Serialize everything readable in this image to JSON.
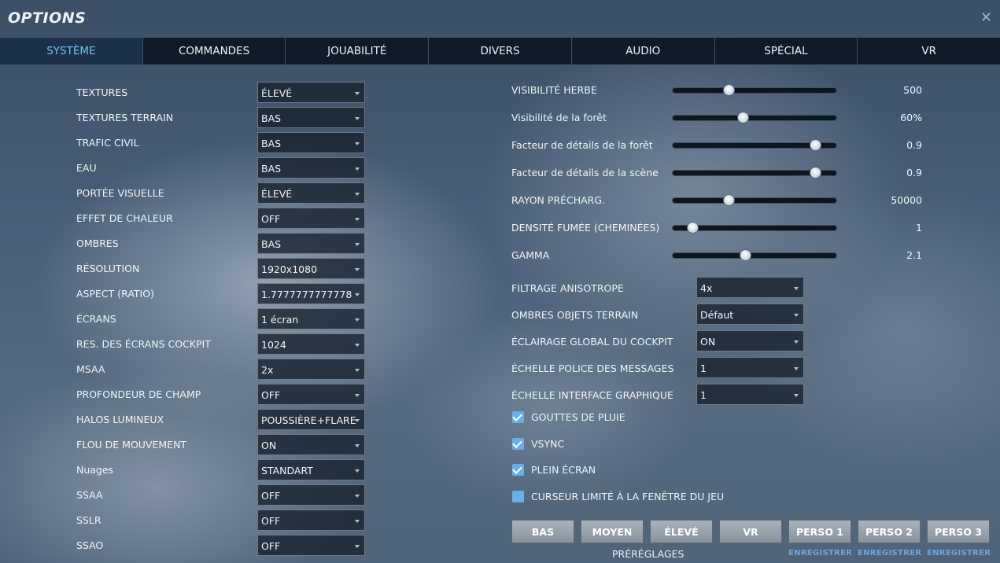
{
  "window": {
    "title": "OPTIONS",
    "close_glyph": "✕"
  },
  "tabs": [
    {
      "label": "SYSTÈME",
      "active": true
    },
    {
      "label": "COMMANDES",
      "active": false
    },
    {
      "label": "JOUABILITÉ",
      "active": false
    },
    {
      "label": "DIVERS",
      "active": false
    },
    {
      "label": "AUDIO",
      "active": false
    },
    {
      "label": "SPÉCIAL",
      "active": false
    },
    {
      "label": "VR",
      "active": false
    }
  ],
  "left_settings": [
    {
      "label": "TEXTURES",
      "value": "ÉLEVÉ"
    },
    {
      "label": "TEXTURES TERRAIN",
      "value": "BAS"
    },
    {
      "label": "TRAFIC CIVIL",
      "value": "BAS"
    },
    {
      "label": "EAU",
      "value": "BAS"
    },
    {
      "label": "PORTÉE VISUELLE",
      "value": "ÉLEVÉ"
    },
    {
      "label": "EFFET DE CHALEUR",
      "value": "OFF"
    },
    {
      "label": "OMBRES",
      "value": "BAS"
    },
    {
      "label": "RÉSOLUTION",
      "value": "1920x1080"
    },
    {
      "label": "ASPECT (RATIO)",
      "value": "1.7777777777778"
    },
    {
      "label": "ÉCRANS",
      "value": "1 écran"
    },
    {
      "label": "RES. DES ÉCRANS COCKPIT",
      "value": "1024"
    },
    {
      "label": "MSAA",
      "value": "2x"
    },
    {
      "label": "PROFONDEUR DE CHAMP",
      "value": "OFF"
    },
    {
      "label": "HALOS LUMINEUX",
      "value": "POUSSIÈRE+FLARE"
    },
    {
      "label": "FLOU DE MOUVEMENT",
      "value": "ON"
    },
    {
      "label": "Nuages",
      "value": "STANDART"
    },
    {
      "label": "SSAA",
      "value": "OFF"
    },
    {
      "label": "SSLR",
      "value": "OFF"
    },
    {
      "label": "SSAO",
      "value": "OFF"
    }
  ],
  "sliders": [
    {
      "label": "VISIBILITÉ HERBE",
      "value": "500",
      "level_pct": 34
    },
    {
      "label": "Visibilité de la forêt",
      "value": "60%",
      "level_pct": 43
    },
    {
      "label": "Facteur de détails de la forêt",
      "value": "0.9",
      "level_pct": 87
    },
    {
      "label": "Facteur de détails de la scène",
      "value": "0.9",
      "level_pct": 87
    },
    {
      "label": "RAYON PRÉCHARG.",
      "value": "50000",
      "level_pct": 34
    },
    {
      "label": "DENSITÉ FUMÉE (CHEMINÉES)",
      "value": "1",
      "level_pct": 12
    },
    {
      "label": "GAMMA",
      "value": "2.1",
      "level_pct": 44
    }
  ],
  "right_settings": [
    {
      "label": "FILTRAGE ANISOTROPE",
      "value": "4x"
    },
    {
      "label": "OMBRES OBJETS TERRAIN",
      "value": "Défaut"
    },
    {
      "label": "ÉCLAIRAGE GLOBAL DU COCKPIT",
      "value": "ON"
    },
    {
      "label": "ÉCHELLE POLICE DES MESSAGES",
      "value": "1"
    },
    {
      "label": "ÉCHELLE INTERFACE GRAPHIQUE",
      "value": "1"
    }
  ],
  "checkboxes": [
    {
      "label": "GOUTTES DE PLUIE",
      "checked": true
    },
    {
      "label": "VSYNC",
      "checked": true
    },
    {
      "label": "PLEIN ÉCRAN",
      "checked": true
    },
    {
      "label": "CURSEUR LIMITÉ À LA FENÊTRE DU JEU",
      "checked": false
    }
  ],
  "presets": {
    "label": "PRÉRÉGLAGES",
    "buttons": [
      "BAS",
      "MOYEN",
      "ÉLEVÉ",
      "VR",
      "PERSO 1",
      "PERSO 2",
      "PERSO 3"
    ],
    "save_label": "ENREGISTRER"
  },
  "colors": {
    "active_tab_text": "#6fc3ef",
    "checkbox": "#6aaee8",
    "save_link": "#6da7dc",
    "tab_bar": "#08121e"
  },
  "icons": {
    "close": "close-icon",
    "dropdown": "chevron-down-icon",
    "checkbox": "checkmark-icon"
  }
}
